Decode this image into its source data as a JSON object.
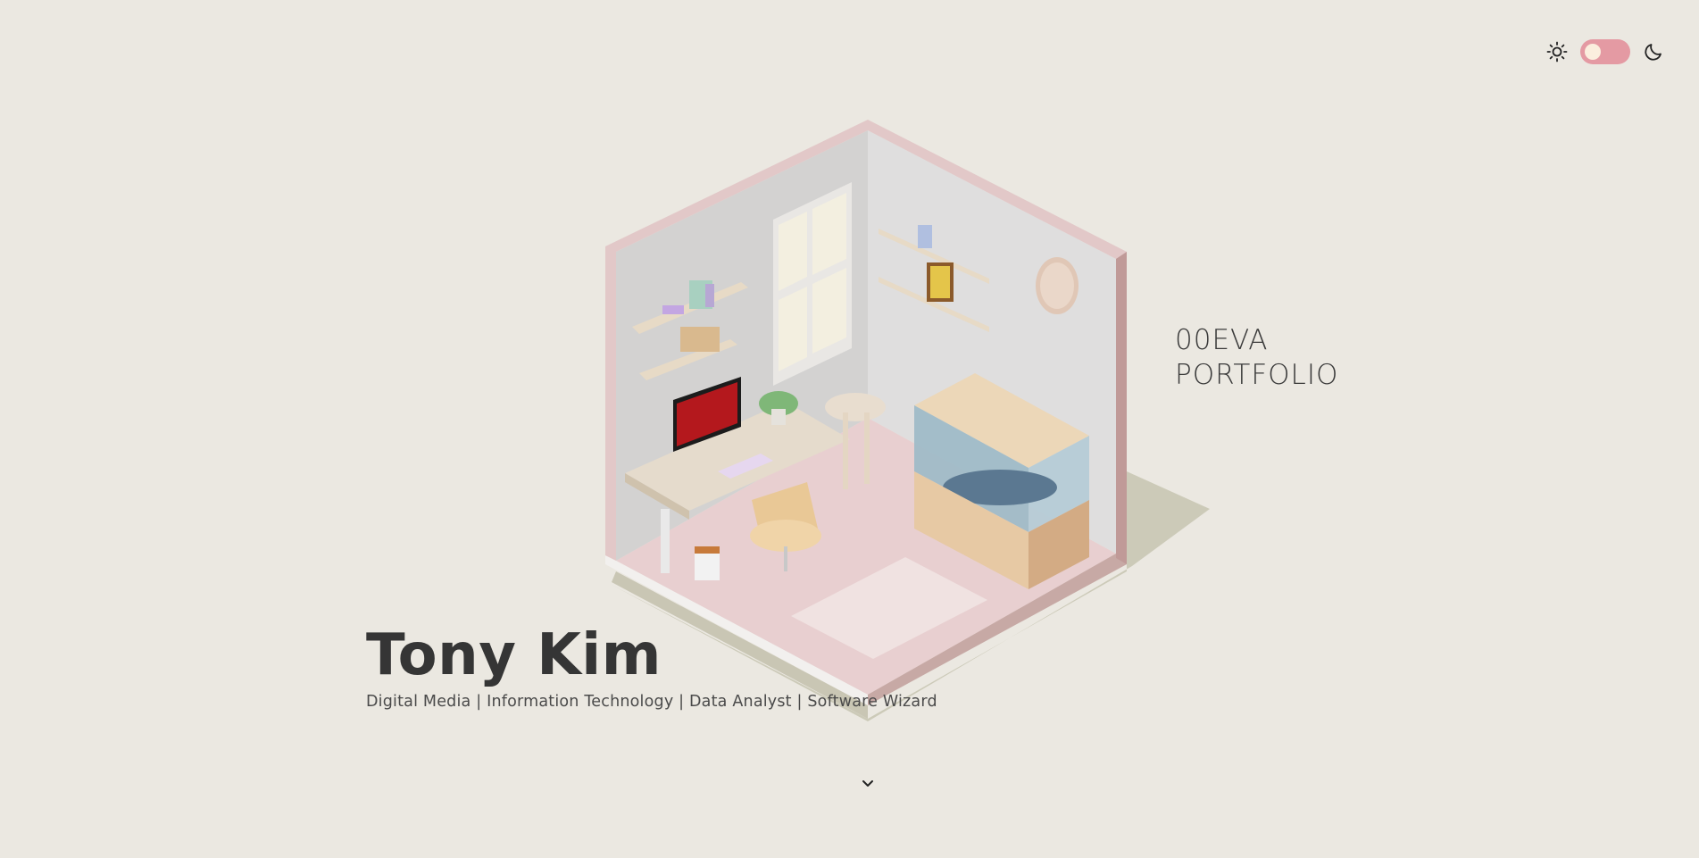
{
  "theme": {
    "light_icon": "sun-icon",
    "dark_icon": "moon-icon",
    "toggle_color": "#e49aa3",
    "knob_color": "#fbeede"
  },
  "brand": {
    "line1": "00EVA",
    "line2": "PORTFOLIO"
  },
  "hero": {
    "name": "Tony Kim",
    "subtitle": "Digital Media | Information Technology | Data Analyst | Software Wizard"
  },
  "scroll": {
    "icon": "chevron-down-icon"
  },
  "colors": {
    "background": "#ebe8e1",
    "text_dark": "#353535",
    "wall_pink": "#e2c8c8",
    "floor_pink": "#e8cfd0"
  }
}
